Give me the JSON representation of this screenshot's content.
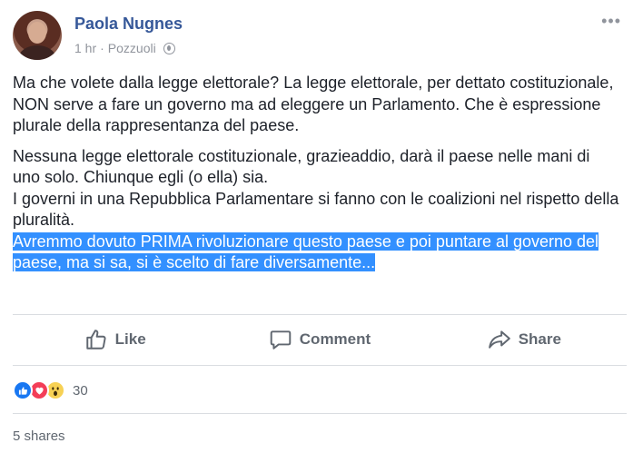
{
  "post": {
    "author": "Paola Nugnes",
    "time": "1 hr",
    "separator": "·",
    "location": "Pozzuoli",
    "privacy_icon": "globe-icon",
    "more_icon": "more-icon",
    "paragraph1": "Ma che volete dalla legge elettorale? La legge elettorale, per dettato costituzionale, NON serve a fare un governo ma ad eleggere un Parlamento. Che è espressione plurale della rappresentanza del paese.",
    "paragraph2_line1": "Nessuna legge elettorale costituzionale, grazieaddio, darà il paese nelle mani di uno solo. Chiunque egli (o ella) sia.",
    "paragraph2_line2": "I governi in una Repubblica Parlamentare si fanno con le coalizioni nel rispetto della pluralità.",
    "paragraph2_selected": "Avremmo dovuto PRIMA rivoluzionare questo paese e poi puntare al governo del paese, ma si sa, si è scelto di fare diversamente...",
    "selection_color": "#3390ff"
  },
  "actions": {
    "like": "Like",
    "comment": "Comment",
    "share": "Share"
  },
  "stats": {
    "reactions": [
      "like",
      "love",
      "wow"
    ],
    "reaction_count": "30",
    "shares": "5 shares"
  },
  "colors": {
    "author": "#365899",
    "meta": "#90949c",
    "action": "#606770"
  }
}
